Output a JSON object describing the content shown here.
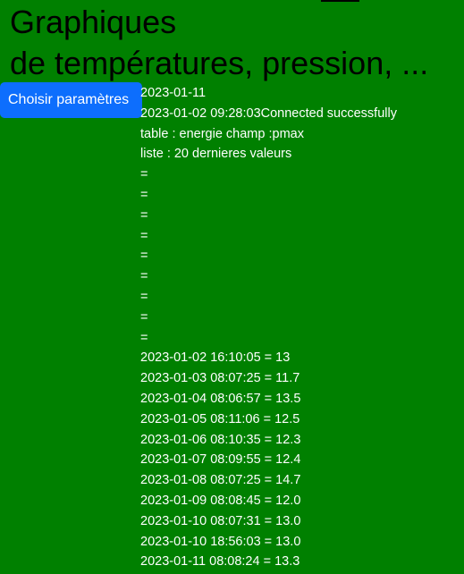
{
  "header": {
    "title_line1": "Graphiques",
    "title_line2": "de températures, pression, ..."
  },
  "toolbar": {
    "choose_params_label": "Choisir paramètres"
  },
  "info": {
    "date": "2023-01-11",
    "connection": "2023-01-02 09:28:03Connected successfully",
    "table": "table : energie champ :pmax",
    "liste": "liste : 20 dernieres valeurs"
  },
  "empty_rows": [
    "=",
    "=",
    "=",
    "=",
    "=",
    "=",
    "=",
    "=",
    "="
  ],
  "values": [
    "2023-01-02 16:10:05 = 13",
    "2023-01-03 08:07:25 = 11.7",
    "2023-01-04 08:06:57 = 13.5",
    "2023-01-05 08:11:06 = 12.5",
    "2023-01-06 08:10:35 = 12.3",
    "2023-01-07 08:09:55 = 12.4",
    "2023-01-08 08:07:25 = 14.7",
    "2023-01-09 08:08:45 = 12.0",
    "2023-01-10 08:07:31 = 13.0",
    "2023-01-10 18:56:03 = 13.0",
    "2023-01-11 08:08:24 = 13.3"
  ],
  "colors": {
    "background": "#008000",
    "button": "#0d6efd",
    "text": "#ffffff",
    "title": "#000000"
  }
}
